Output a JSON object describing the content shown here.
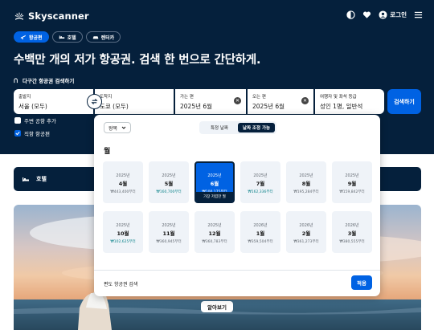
{
  "header": {
    "brand": "Skyscanner",
    "login_label": "로그인",
    "icons": [
      "globe-icon",
      "heart-icon",
      "user-icon",
      "menu-icon"
    ]
  },
  "tabs": [
    {
      "label": "항공편",
      "icon": "plane-icon",
      "active": true
    },
    {
      "label": "호텔",
      "icon": "bed-icon",
      "active": false
    },
    {
      "label": "렌터카",
      "icon": "car-icon",
      "active": false
    }
  ],
  "headline": "수백만 개의 저가 항공권. 검색 한 번으로 간단하게.",
  "multi_city_label": "다구간 항공권 검색하기",
  "search": {
    "from": {
      "label": "출발지",
      "value": "서울 (모두)"
    },
    "to": {
      "label": "도착지",
      "value": "도쿄 (모두)"
    },
    "depart": {
      "label": "가는 편",
      "value": "2025년 6월"
    },
    "return": {
      "label": "오는 편",
      "value": "2025년 6월"
    },
    "travellers": {
      "label": "여행자 및 좌석 등급",
      "value": "성인 1명, 일반석"
    },
    "button": "검색하기"
  },
  "options": {
    "nearby": {
      "label": "주변 공항 추가",
      "checked": false
    },
    "direct": {
      "label": "직항 항공편",
      "checked": true
    }
  },
  "hotel_strip": {
    "label": "호텔"
  },
  "explore_label": "알아보기",
  "date_popup": {
    "trip_select": "왕복",
    "toggle": [
      "특정 날짜",
      "날짜 조정 가능"
    ],
    "toggle_active": 1,
    "section_title": "월",
    "months": [
      {
        "year": "2025년",
        "month": "4월",
        "price": "₩443,400부터",
        "highlight": false
      },
      {
        "year": "2025년",
        "month": "5월",
        "price": "₩160,700부터",
        "highlight": true
      },
      {
        "year": "2025년",
        "month": "6월",
        "price": "₩100,175부터",
        "highlight": true,
        "selected": true,
        "tag": "가장 저렴한 월"
      },
      {
        "year": "2025년",
        "month": "7월",
        "price": "₩162,336부터",
        "highlight": true
      },
      {
        "year": "2025년",
        "month": "8월",
        "price": "₩195,284부터",
        "highlight": false
      },
      {
        "year": "2025년",
        "month": "9월",
        "price": "₩159,842부터",
        "highlight": false
      },
      {
        "year": "2025년",
        "month": "10월",
        "price": "₩102,625부터",
        "highlight": true
      },
      {
        "year": "2025년",
        "month": "11월",
        "price": "₩360,945부터",
        "highlight": false
      },
      {
        "year": "2025년",
        "month": "12월",
        "price": "₩360,783부터",
        "highlight": false
      },
      {
        "year": "2026년",
        "month": "1월",
        "price": "₩359,504부터",
        "highlight": false
      },
      {
        "year": "2026년",
        "month": "2월",
        "price": "₩361,273부터",
        "highlight": false
      },
      {
        "year": "2026년",
        "month": "3월",
        "price": "₩380,555부터",
        "highlight": false
      }
    ],
    "oneway_label": "편도 항공권 검색",
    "apply_label": "적용"
  },
  "colors": {
    "navy": "#05203c",
    "accent": "#0062e3",
    "price_green": "#0c838a"
  }
}
